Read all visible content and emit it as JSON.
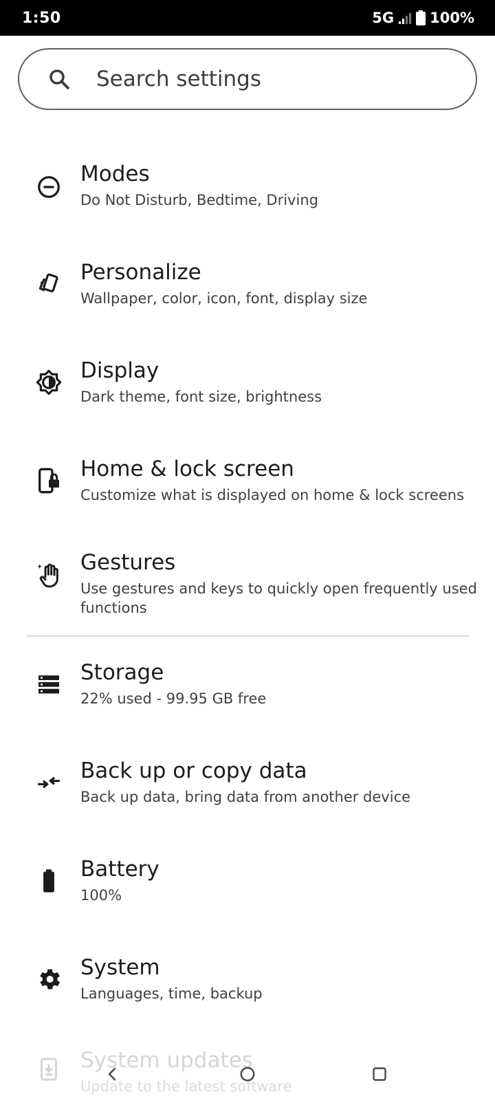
{
  "status_bar": {
    "time": "1:50",
    "network": "5G",
    "battery": "100%",
    "icons": [
      "signal-icon",
      "battery-icon"
    ]
  },
  "search": {
    "placeholder": "Search settings",
    "icon": "search-icon"
  },
  "items": [
    {
      "title": "Modes",
      "subtitle": "Do Not Disturb, Bedtime, Driving",
      "icon": "modes-icon"
    },
    {
      "title": "Personalize",
      "subtitle": "Wallpaper, color, icon, font, display size",
      "icon": "personalize-icon"
    },
    {
      "title": "Display",
      "subtitle": "Dark theme, font size, brightness",
      "icon": "display-icon"
    },
    {
      "title": "Home & lock screen",
      "subtitle": "Customize what is displayed on home & lock screens",
      "icon": "home-lock-icon"
    },
    {
      "title": "Gestures",
      "subtitle": "Use gestures and keys to quickly open frequently used functions",
      "icon": "gestures-icon"
    },
    {
      "title": "Storage",
      "subtitle": "22% used - 99.95 GB free",
      "icon": "storage-icon"
    },
    {
      "title": "Back up or copy data",
      "subtitle": "Back up data, bring data from another device",
      "icon": "backup-icon"
    },
    {
      "title": "Battery",
      "subtitle": "100%",
      "icon": "battery-icon"
    },
    {
      "title": "System",
      "subtitle": "Languages, time, backup",
      "icon": "gear-icon"
    },
    {
      "title": "System updates",
      "subtitle": "Update to the latest software",
      "icon": "system-update-icon"
    }
  ],
  "nav_bar": {
    "buttons": [
      "back-icon",
      "home-icon",
      "recents-icon"
    ]
  },
  "colors": {
    "status_bar_bg": "#000000",
    "background": "#ffffff",
    "title_text": "#1b1c1f",
    "subtitle_text": "#3f4044",
    "divider": "#d9d9dc"
  }
}
